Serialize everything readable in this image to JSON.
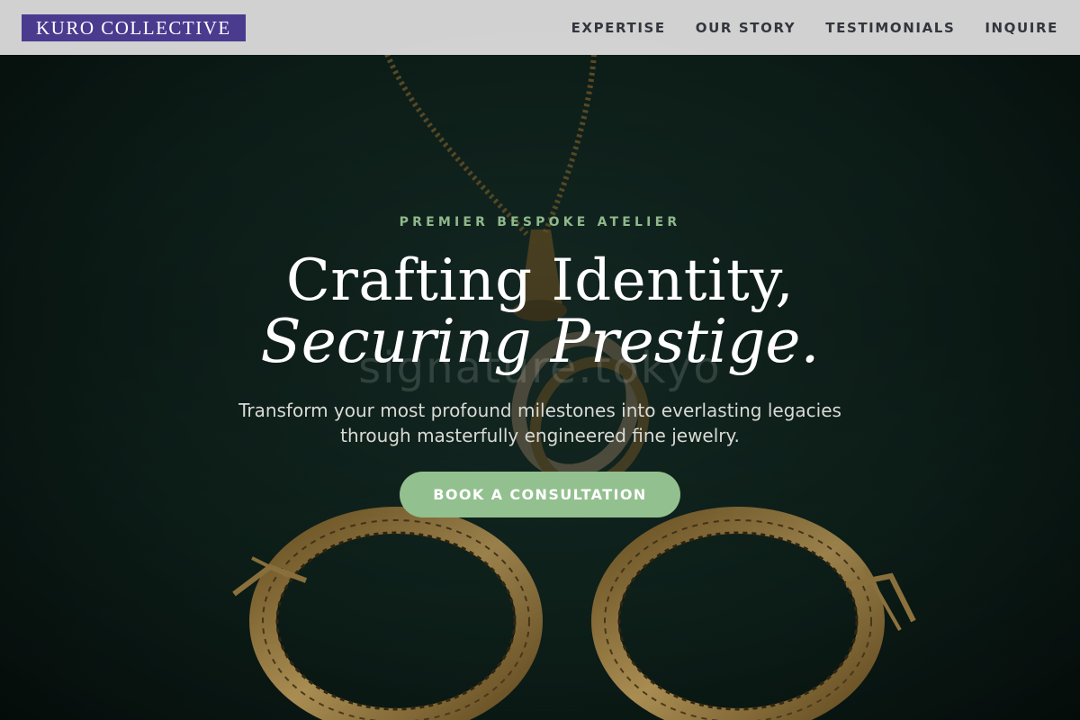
{
  "brand": {
    "logo_text": "KURO COLLECTIVE"
  },
  "nav": {
    "items": [
      "EXPERTISE",
      "OUR STORY",
      "TESTIMONIALS",
      "INQUIRE"
    ]
  },
  "hero": {
    "eyebrow": "PREMIER BESPOKE ATELIER",
    "headline_line1": "Crafting Identity,",
    "headline_line2": "Securing Prestige.",
    "subtitle": "Transform your most profound milestones into everlasting legacies through masterfully engineered fine jewelry.",
    "cta_label": "BOOK A CONSULTATION",
    "watermark": "signature.tokyo"
  },
  "colors": {
    "header_bg": "#d8d8d8",
    "logo_bg": "#4b3b8f",
    "nav_text": "#33363d",
    "eyebrow": "#8fb98c",
    "cta_bg": "#93c08f",
    "hero_bg": "#0d1f1a",
    "gold": "#b8954c"
  }
}
